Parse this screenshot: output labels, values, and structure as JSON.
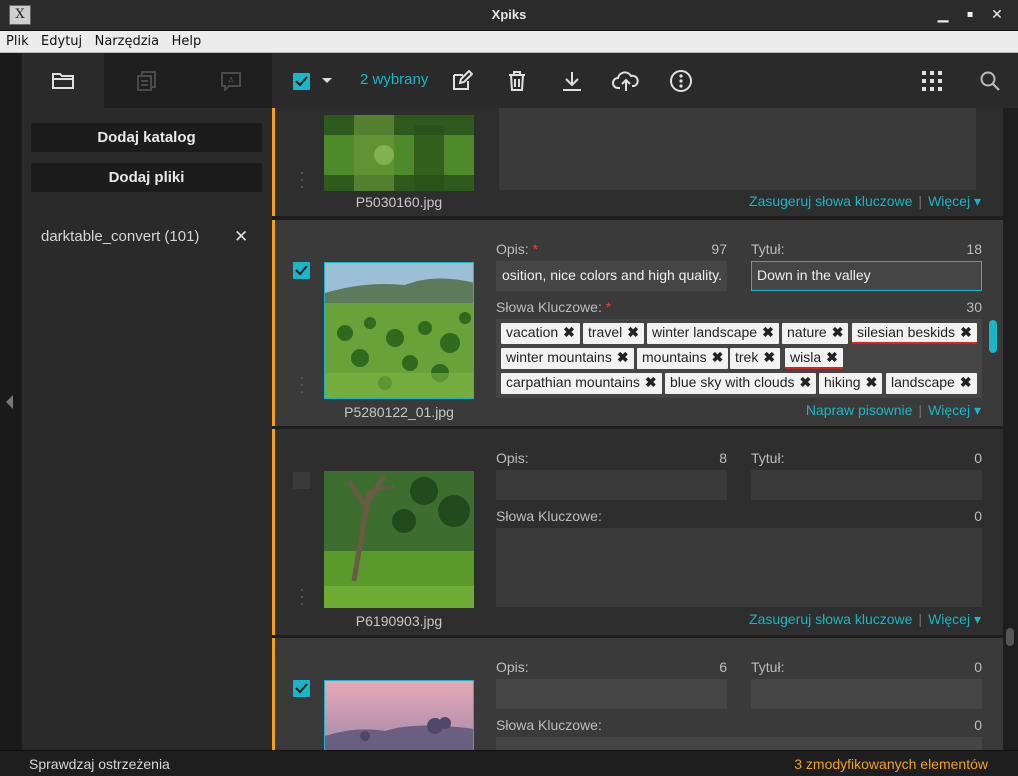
{
  "window": {
    "title": "Xpiks",
    "minimize": "▁",
    "maximize": "▪",
    "close": "✕"
  },
  "menu": {
    "items": [
      "Plik",
      "Edytuj",
      "Narzędzia",
      "Help"
    ]
  },
  "sidebar": {
    "tabs": [
      "folder-icon",
      "files-icon",
      "spellcheck-icon"
    ],
    "add_directory": "Dodaj katalog",
    "add_files": "Dodaj pliki",
    "directories": [
      {
        "label": "darktable_convert (101)"
      }
    ]
  },
  "toolbar": {
    "selected_count": "2 wybrany",
    "icons": [
      "edit-icon",
      "trash-icon",
      "download-icon",
      "upload-cloud-icon",
      "more-icon",
      "grid-icon",
      "search-icon"
    ]
  },
  "items": [
    {
      "filename": "P5030160.jpg",
      "links": {
        "suggest": "Zasugeruj słowa kluczowe",
        "more": "Więcej ▾"
      }
    },
    {
      "filename": "P5280122_01.jpg",
      "selected": true,
      "desc_label": "Opis:",
      "desc_count": "97",
      "desc_value": "osition, nice colors and high quality.",
      "title_label": "Tytuł:",
      "title_count": "18",
      "title_value": "Down in the valley",
      "kw_label": "Słowa Kluczowe:",
      "kw_count": "30",
      "keywords": [
        {
          "text": "vacation",
          "err": false
        },
        {
          "text": "travel",
          "err": false
        },
        {
          "text": "winter landscape",
          "err": false
        },
        {
          "text": "nature",
          "err": false
        },
        {
          "text": "silesian beskids",
          "err": true
        },
        {
          "text": "winter mountains",
          "err": false
        },
        {
          "text": "mountains",
          "err": false
        },
        {
          "text": "trek",
          "err": false
        },
        {
          "text": "wisla",
          "err": true
        },
        {
          "text": "carpathian mountains",
          "err": false
        },
        {
          "text": "blue sky with clouds",
          "err": false
        },
        {
          "text": "hiking",
          "err": false
        },
        {
          "text": "landscape",
          "err": false
        }
      ],
      "links": {
        "fix": "Napraw pisownie",
        "more": "Więcej ▾"
      }
    },
    {
      "filename": "P6190903.jpg",
      "selected": false,
      "desc_label": "Opis:",
      "desc_count": "8",
      "title_label": "Tytuł:",
      "title_count": "0",
      "kw_label": "Słowa Kluczowe:",
      "kw_count": "0",
      "links": {
        "suggest": "Zasugeruj słowa kluczowe",
        "more": "Więcej ▾"
      }
    },
    {
      "selected": true,
      "desc_label": "Opis:",
      "desc_count": "6",
      "title_label": "Tytuł:",
      "title_count": "0",
      "kw_label": "Słowa Kluczowe:",
      "kw_count": "0"
    }
  ],
  "status": {
    "left": "Sprawdzaj ostrzeżenia",
    "right": "3 zmodyfikowanych elementów"
  },
  "colors": {
    "accent": "#19b6c7",
    "modified": "#f0a21f",
    "required": "#e8413f"
  }
}
